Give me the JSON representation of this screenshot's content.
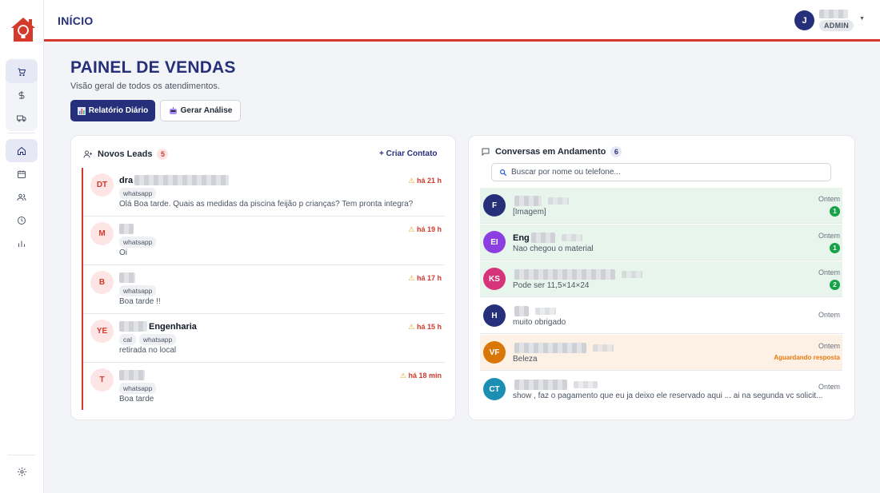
{
  "topbar": {
    "title": "INÍCIO",
    "avatar_initial": "J",
    "role_badge": "ADMIN"
  },
  "page": {
    "title": "PAINEL DE VENDAS",
    "subtitle": "Visão geral de todos os atendimentos.",
    "btn_report": "Relatório Diário",
    "btn_analysis": "Gerar Análise"
  },
  "leads": {
    "title": "Novos Leads",
    "count": "5",
    "create_label": "+ Criar Contato",
    "items": [
      {
        "initials": "DT",
        "name": "dra",
        "time": "há 21 h",
        "tags": [
          "whatsapp"
        ],
        "message": "Olá Boa tarde. Quais as medidas da piscina feijão p crianças? Tem pronta integra?"
      },
      {
        "initials": "M",
        "name": "",
        "time": "há 19 h",
        "tags": [
          "whatsapp"
        ],
        "message": "Oi"
      },
      {
        "initials": "B",
        "name": "",
        "time": "há 17 h",
        "tags": [
          "whatsapp"
        ],
        "message": "Boa tarde !!"
      },
      {
        "initials": "YE",
        "name": "Engenharia",
        "time": "há 15 h",
        "tags": [
          "cal",
          "whatsapp"
        ],
        "message": "retirada no local"
      },
      {
        "initials": "T",
        "name": "",
        "time": "há 18 min",
        "tags": [
          "whatsapp"
        ],
        "message": "Boa tarde"
      }
    ]
  },
  "conversations": {
    "title": "Conversas em Andamento",
    "count": "6",
    "search_placeholder": "Buscar por nome ou telefone...",
    "items": [
      {
        "initials": "F",
        "name": "",
        "message": "[Imagem]",
        "time": "Ontem",
        "badge": "1",
        "status": "",
        "color": "#26307a",
        "bg": "#e8f5ec"
      },
      {
        "initials": "EI",
        "name": "Eng",
        "message": "Nao chegou o material",
        "time": "Ontem",
        "badge": "1",
        "status": "",
        "color": "#8b3fe0",
        "bg": "#e8f5ec"
      },
      {
        "initials": "KS",
        "name": "",
        "message": "Pode ser 11,5×14×24",
        "time": "Ontem",
        "badge": "2",
        "status": "",
        "color": "#d6337a",
        "bg": "#e8f5ec"
      },
      {
        "initials": "H",
        "name": "",
        "message": "muito obrigado",
        "time": "Ontem",
        "badge": "",
        "status": "",
        "color": "#26307a",
        "bg": "#ffffff"
      },
      {
        "initials": "VF",
        "name": "",
        "message": "Beleza",
        "time": "Ontem",
        "badge": "",
        "status": "Aguardando resposta",
        "color": "#d97706",
        "bg": "#fdf0e4"
      },
      {
        "initials": "CT",
        "name": "",
        "message": "show , faz o pagamento que eu ja deixo ele reservado aqui ... ai na segunda vc solicit...",
        "time": "Ontem",
        "badge": "",
        "status": "",
        "color": "#1b8fb3",
        "bg": "#ffffff"
      }
    ]
  },
  "icons": {
    "sidebar": [
      "cart-icon",
      "dollar-icon",
      "truck-icon",
      "home-icon",
      "calendar-icon",
      "users-icon",
      "clock-icon",
      "bar-chart-icon",
      "settings-icon"
    ]
  }
}
